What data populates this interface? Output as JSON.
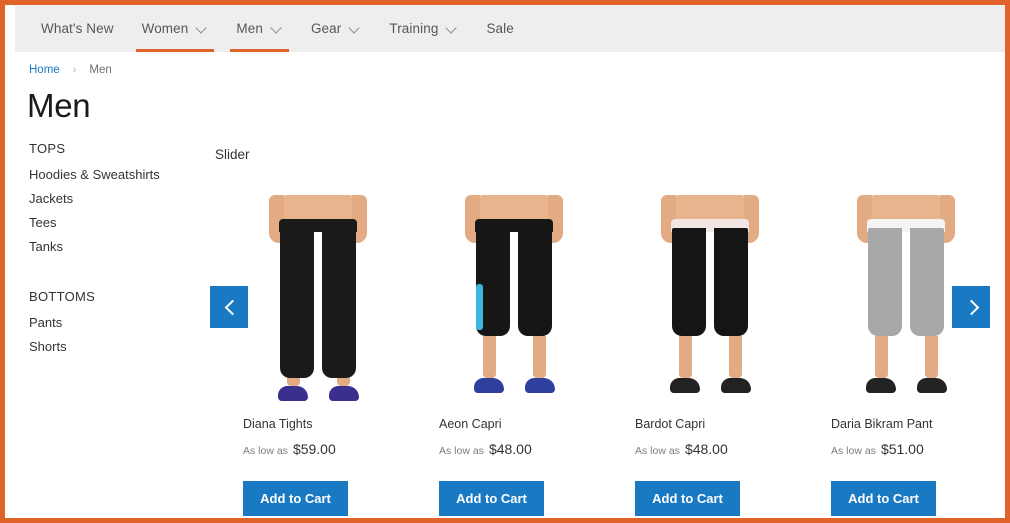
{
  "theme": {
    "frame_border": "#e0642a",
    "nav_bg": "#eeeeee",
    "accent_orange": "#e0642a",
    "button_blue": "#1979c3",
    "link_blue": "#1979c3",
    "text_dark": "#333333",
    "text_muted": "#7d7d7d"
  },
  "topnav": {
    "items": [
      {
        "label": "What's New",
        "has_dropdown": false,
        "active": false
      },
      {
        "label": "Women",
        "has_dropdown": true,
        "active": true
      },
      {
        "label": "Men",
        "has_dropdown": true,
        "active": true
      },
      {
        "label": "Gear",
        "has_dropdown": true,
        "active": false
      },
      {
        "label": "Training",
        "has_dropdown": true,
        "active": false
      },
      {
        "label": "Sale",
        "has_dropdown": false,
        "active": false
      }
    ]
  },
  "breadcrumb": {
    "home_label": "Home",
    "separator": "›",
    "current_label": "Men"
  },
  "page": {
    "title": "Men"
  },
  "sidebar": {
    "groups": [
      {
        "title": "TOPS",
        "items": [
          "Hoodies & Sweatshirts",
          "Jackets",
          "Tees",
          "Tanks"
        ]
      },
      {
        "title": "BOTTOMS",
        "items": [
          "Pants",
          "Shorts"
        ]
      }
    ]
  },
  "slider": {
    "heading": "Slider",
    "prev_icon": "chevron-left-icon",
    "next_icon": "chevron-right-icon",
    "add_to_cart_label": "Add to Cart",
    "price_prefix": "As low as",
    "products": [
      {
        "name": "Diana Tights",
        "price": "$59.00",
        "style": {
          "pant_color": "#1a1a1a",
          "waist_color": "#1a1a1a",
          "shoe_color": "#3a2f8f",
          "length": "full",
          "side_stripe": false
        }
      },
      {
        "name": "Aeon Capri",
        "price": "$48.00",
        "style": {
          "pant_color": "#161616",
          "waist_color": "#161616",
          "shoe_color": "#2e3f9e",
          "length": "capri",
          "side_stripe": true
        }
      },
      {
        "name": "Bardot Capri",
        "price": "$48.00",
        "style": {
          "pant_color": "#151515",
          "waist_color": "#f2e6e4",
          "shoe_color": "#222222",
          "length": "capri",
          "side_stripe": false
        }
      },
      {
        "name": "Daria Bikram Pant",
        "price": "$51.00",
        "style": {
          "pant_color": "#a8a8a8",
          "waist_color": "#f4f4f4",
          "shoe_color": "#232323",
          "length": "capri",
          "side_stripe": false
        }
      }
    ]
  }
}
